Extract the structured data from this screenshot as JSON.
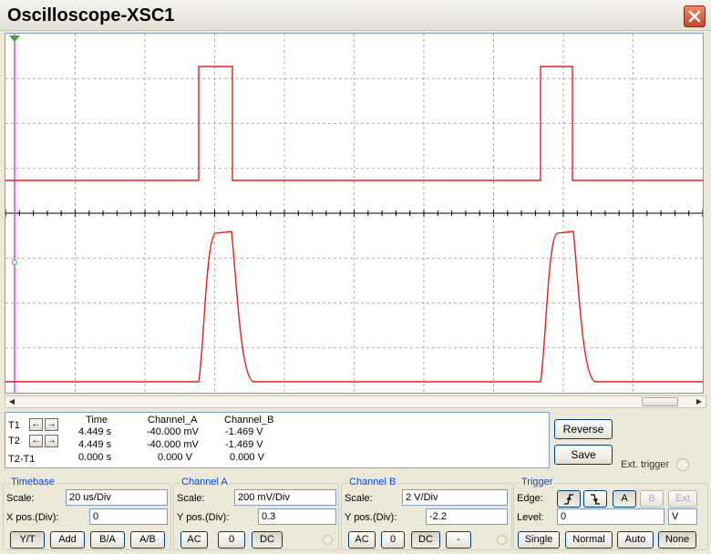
{
  "window": {
    "title": "Oscilloscope-XSC1"
  },
  "colors": {
    "trace": "#e2231a",
    "grid": "#9a9a9a",
    "cursor": "#e040e0",
    "accent": "#0046d5"
  },
  "readout": {
    "headers": [
      "Time",
      "Channel_A",
      "Channel_B"
    ],
    "rows": [
      {
        "label": "T1",
        "time": "4.449 s",
        "a": "-40.000 mV",
        "b": "-1.469 V"
      },
      {
        "label": "T2",
        "time": "4.449 s",
        "a": "-40.000 mV",
        "b": "-1.469 V"
      },
      {
        "label": "T2-T1",
        "time": "0.000 s",
        "a": "0.000 V",
        "b": "0.000 V"
      }
    ]
  },
  "actions": {
    "reverse": "Reverse",
    "save": "Save",
    "ext_trigger": "Ext. trigger"
  },
  "timebase": {
    "title": "Timebase",
    "scale_label": "Scale:",
    "scale": "20 us/Div",
    "xpos_label": "X pos.(Div):",
    "xpos": "0",
    "modes": [
      "Y/T",
      "Add",
      "B/A",
      "A/B"
    ]
  },
  "channel_a": {
    "title": "Channel A",
    "scale_label": "Scale:",
    "scale": "200 mV/Div",
    "ypos_label": "Y pos.(Div):",
    "ypos": "0.3",
    "coupling": [
      "AC",
      "0",
      "DC"
    ]
  },
  "channel_b": {
    "title": "Channel B",
    "scale_label": "Scale:",
    "scale": "2  V/Div",
    "ypos_label": "Y pos.(Div):",
    "ypos": "-2.2",
    "coupling": [
      "AC",
      "0",
      "DC",
      "-"
    ]
  },
  "trigger": {
    "title": "Trigger",
    "edge_label": "Edge:",
    "level_label": "Level:",
    "level": "0",
    "level_unit": "V",
    "sources": [
      "A",
      "B",
      "Ext"
    ],
    "modes": [
      "Single",
      "Normal",
      "Auto",
      "None"
    ]
  }
}
